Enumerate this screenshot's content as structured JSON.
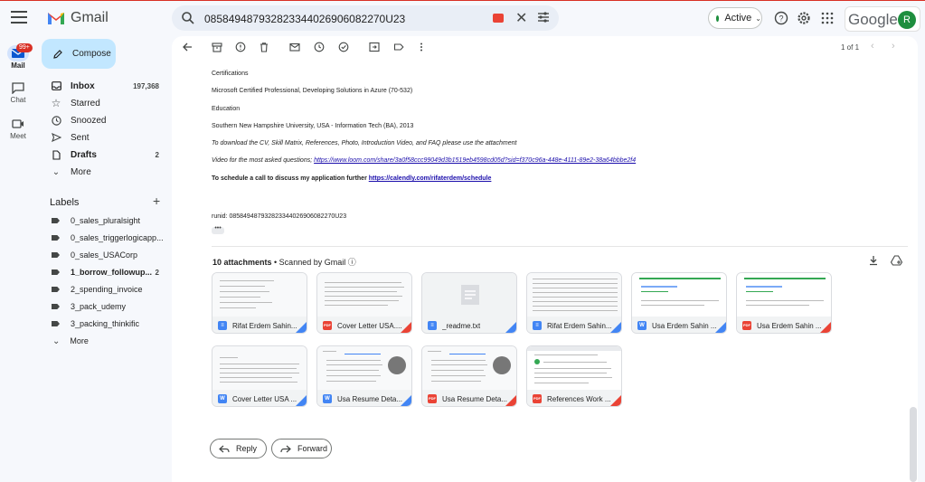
{
  "app": {
    "name": "Gmail"
  },
  "search": {
    "query": "085849487932823344026906082270U23"
  },
  "status": {
    "label": "Active"
  },
  "account": {
    "brand": "Google",
    "avatar_letter": "R"
  },
  "rail": {
    "mail": {
      "label": "Mail",
      "badge": "99+"
    },
    "chat": {
      "label": "Chat"
    },
    "meet": {
      "label": "Meet"
    }
  },
  "compose": {
    "label": "Compose"
  },
  "nav": [
    {
      "label": "Inbox",
      "count": "197,368",
      "icon": "inbox-icon",
      "bold": true
    },
    {
      "label": "Starred",
      "count": "",
      "icon": "star-icon",
      "bold": false
    },
    {
      "label": "Snoozed",
      "count": "",
      "icon": "clock-icon",
      "bold": false
    },
    {
      "label": "Sent",
      "count": "",
      "icon": "send-icon",
      "bold": false
    },
    {
      "label": "Drafts",
      "count": "2",
      "icon": "draft-icon",
      "bold": true
    },
    {
      "label": "More",
      "count": "",
      "icon": "chevron-down-icon",
      "bold": false
    }
  ],
  "labels": {
    "heading": "Labels",
    "items": [
      {
        "label": "0_sales_pluralsight",
        "count": "",
        "bold": false
      },
      {
        "label": "0_sales_triggerlogicapp...",
        "count": "",
        "bold": false
      },
      {
        "label": "0_sales_USACorp",
        "count": "",
        "bold": false
      },
      {
        "label": "1_borrow_followup...",
        "count": "2",
        "bold": true
      },
      {
        "label": "2_spending_invoice",
        "count": "",
        "bold": false
      },
      {
        "label": "3_pack_udemy",
        "count": "",
        "bold": false
      },
      {
        "label": "3_packing_thinkific",
        "count": "",
        "bold": false
      }
    ],
    "more": "More"
  },
  "pager": {
    "text": "1 of 1"
  },
  "email": {
    "lines": [
      {
        "text": "Certifications",
        "style": "normal"
      },
      {
        "text": "Microsoft Certified Professional, Developing Solutions in Azure (70-532)",
        "style": "normal"
      },
      {
        "text": "Education",
        "style": "normal"
      },
      {
        "text": "Southern New Hampshire University, USA - Information Tech (BA), 2013",
        "style": "normal"
      },
      {
        "text": "To download the CV, Skill Matrix, References, Photo, Introduction Video, and FAQ please use the attachment",
        "style": "italic"
      }
    ],
    "video_prefix": "Video for the most asked questions; ",
    "video_link": "https://www.loom.com/share/3a0f58ccc99049d3b1519eb4598cd05d?sid=f370c96a-448e-4111-89e2-38a64bbbe2f4",
    "schedule_prefix": "To schedule a call to discuss my application further ",
    "schedule_link": "https://calendly.com/rifaterdem/schedule",
    "runid": "runid: 085849487932823344026906082270U23",
    "ellipsis": "•••"
  },
  "attachments": {
    "count_label": "10 attachments",
    "scanned": " • Scanned by Gmail ⓘ",
    "items": [
      {
        "name": "Rifat Erdem Sahin...",
        "type": "docs",
        "color": "#4285f4",
        "letter": "≡"
      },
      {
        "name": "Cover Letter USA....",
        "type": "pdf",
        "color": "#ea4335",
        "letter": "PDF"
      },
      {
        "name": "_readme.txt",
        "type": "txt",
        "color": "#4285f4",
        "letter": "≡"
      },
      {
        "name": "Rifat Erdem Sahin...",
        "type": "docs",
        "color": "#4285f4",
        "letter": "≡"
      },
      {
        "name": "Usa Erdem Sahin ...",
        "type": "word",
        "color": "#4285f4",
        "letter": "W"
      },
      {
        "name": "Usa Erdem Sahin ...",
        "type": "pdf",
        "color": "#ea4335",
        "letter": "PDF"
      },
      {
        "name": "Cover Letter USA ...",
        "type": "word",
        "color": "#4285f4",
        "letter": "W"
      },
      {
        "name": "Usa Resume Deta...",
        "type": "word",
        "color": "#4285f4",
        "letter": "W"
      },
      {
        "name": "Usa Resume Deta...",
        "type": "pdf",
        "color": "#ea4335",
        "letter": "PDF"
      },
      {
        "name": "References Work ...",
        "type": "pdf",
        "color": "#ea4335",
        "letter": "PDF"
      }
    ]
  },
  "actions": {
    "reply": "Reply",
    "forward": "Forward"
  },
  "colors": {
    "accent": "#0b57d0",
    "compose_bg": "#c2e7ff",
    "active_dot": "#1e8e3e"
  }
}
